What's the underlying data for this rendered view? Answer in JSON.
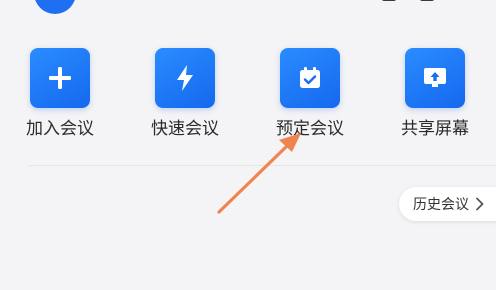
{
  "actions": [
    {
      "label": "加入会议",
      "icon": "plus-icon"
    },
    {
      "label": "快速会议",
      "icon": "lightning-icon"
    },
    {
      "label": "预定会议",
      "icon": "calendar-check-icon"
    },
    {
      "label": "共享屏幕",
      "icon": "share-screen-icon"
    }
  ],
  "history_button": {
    "label": "历史会议",
    "icon": "chevron-right-icon"
  },
  "colors": {
    "accent": "#1f6ff2",
    "annotation_arrow": "#f08450"
  }
}
